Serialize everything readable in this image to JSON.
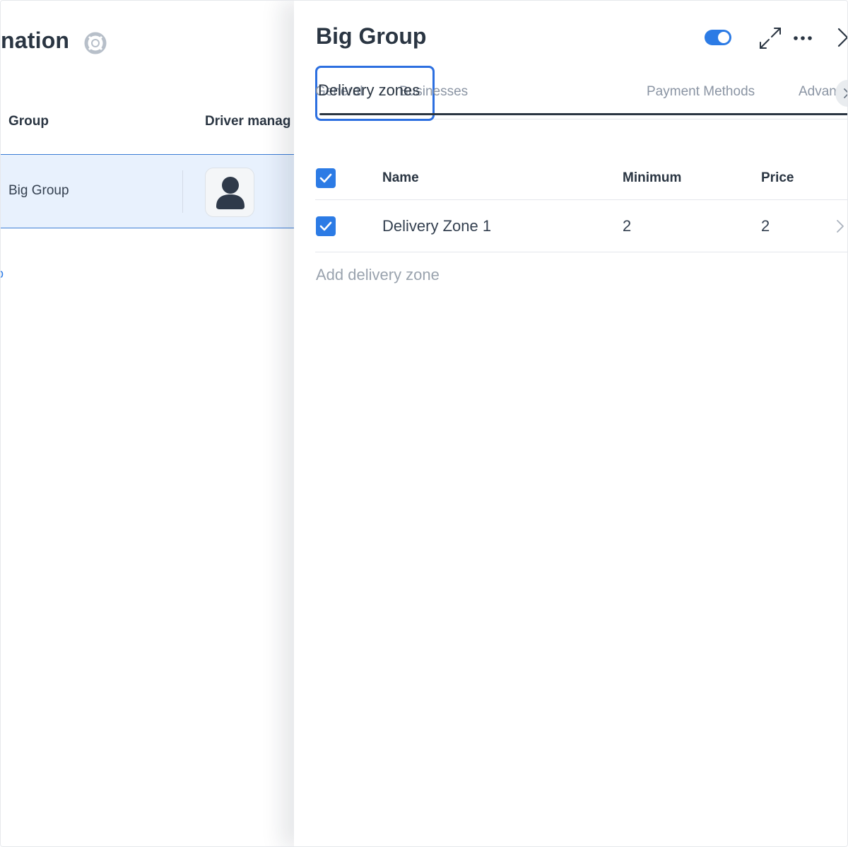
{
  "left": {
    "title": "nation",
    "columns": {
      "group": "Group",
      "driver": "Driver manag"
    },
    "row": {
      "name": "Big Group"
    },
    "link": "o"
  },
  "drawer": {
    "title": "Big Group",
    "toggle_on": true,
    "tabs": [
      {
        "label": "General",
        "active": false
      },
      {
        "label": "Businesses",
        "active": false
      },
      {
        "label": "Delivery zones",
        "active": true
      },
      {
        "label": "Payment Methods",
        "active": false
      },
      {
        "label": "Advan",
        "active": false
      }
    ],
    "table": {
      "headers": {
        "name": "Name",
        "minimum": "Minimum",
        "price": "Price"
      },
      "rows": [
        {
          "checked": true,
          "name": "Delivery Zone 1",
          "minimum": "2",
          "price": "2"
        }
      ]
    },
    "add_label": "Add delivery zone"
  },
  "colors": {
    "accent": "#2c7be5",
    "selected_row_bg": "#e8f1fd",
    "heading": "#2a3542",
    "muted": "#8a94a3"
  }
}
